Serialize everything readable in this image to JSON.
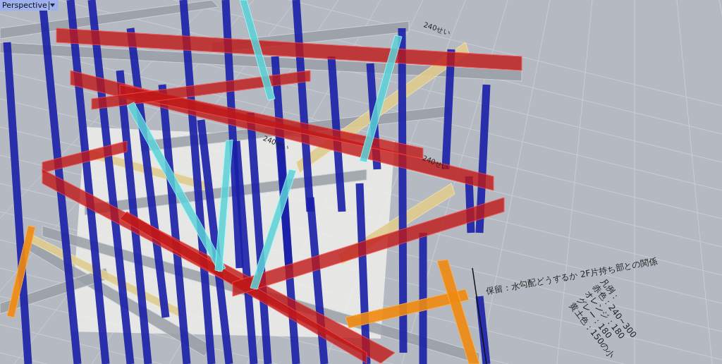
{
  "viewport": {
    "label": "Perspective",
    "annotations": [
      {
        "text": "240せい"
      },
      {
        "text": "240せい"
      },
      {
        "text": "240せい"
      }
    ],
    "note": "保留：水勾配どうするか 2F片持ち部との関係",
    "legend": [
      "凡例：",
      "赤色：240~300",
      "オレンジ：180",
      "グレー：180",
      "黄土色：150の小"
    ]
  }
}
